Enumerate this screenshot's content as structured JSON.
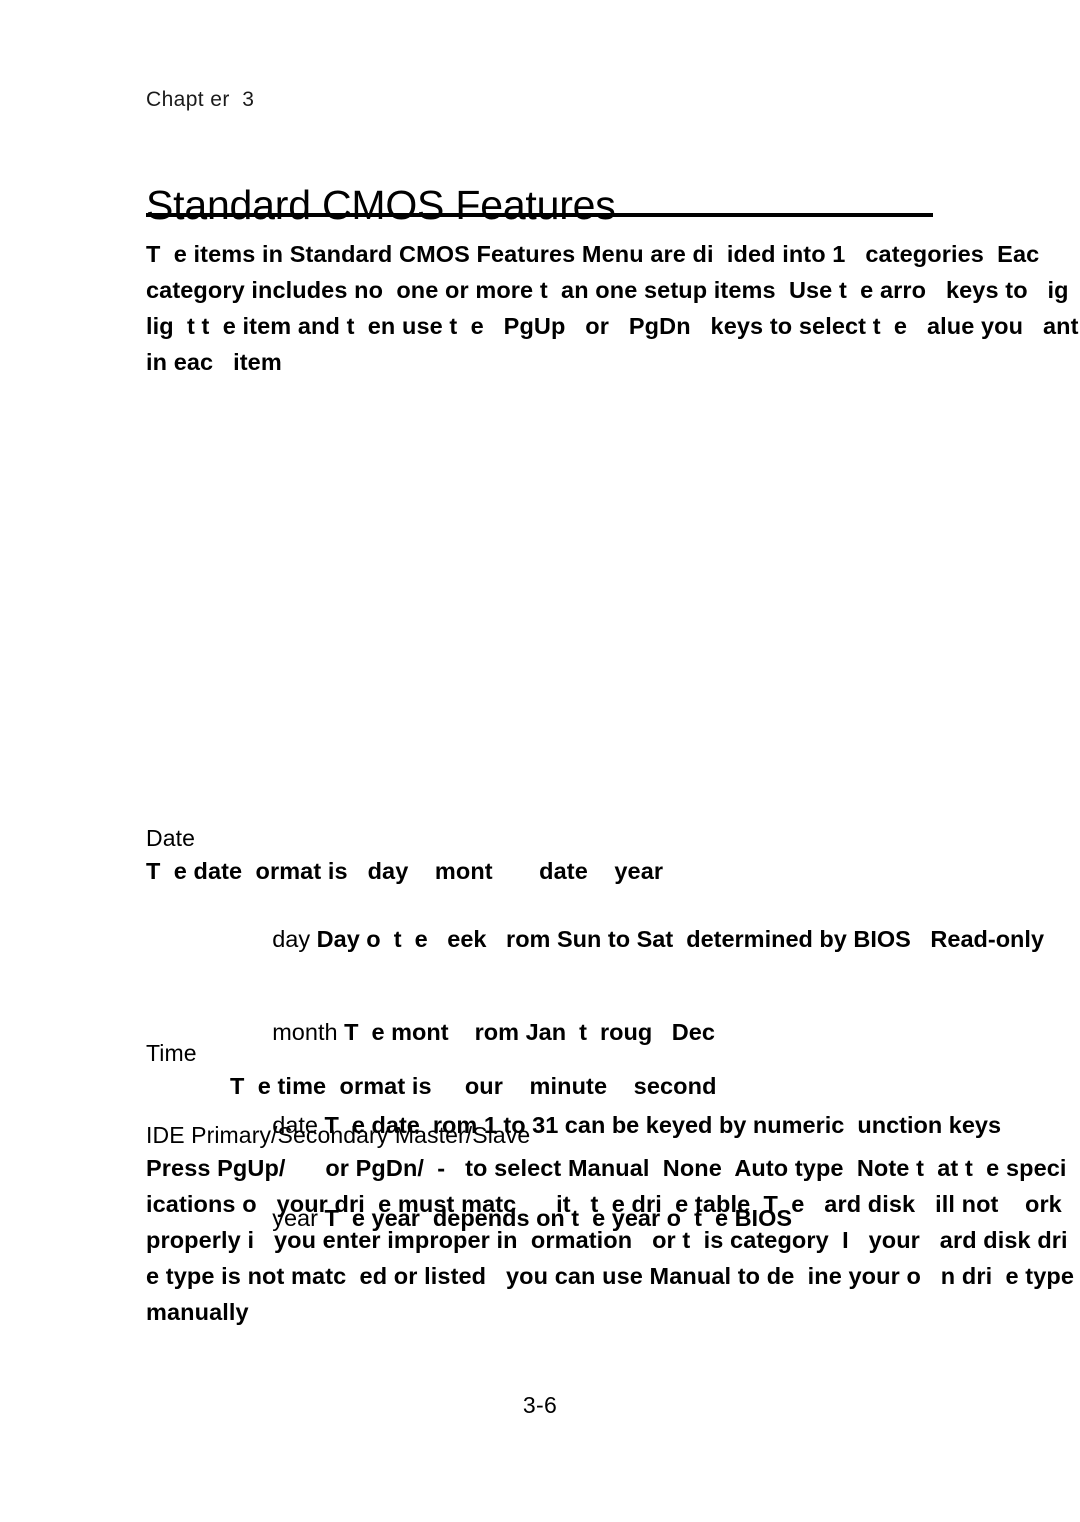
{
  "document": {
    "chapter_label": "Chapt er  3",
    "title": "Standard CMOS Features",
    "page_number": "3-6"
  },
  "intro": {
    "text": "T  e items in Standard CMOS Features Menu are di  ided into 1   categories  Eac   category includes no  one or more t  an one setup items  Use t  e arro   keys to   ig  lig  t t  e item and t  en use t  e   PgUp   or   PgDn   keys to select t  e   alue you   ant in eac   item"
  },
  "sections": [
    {
      "name": "date",
      "heading": "Date",
      "body": "T  e date  ormat is   day    mont       date    year",
      "definitions": [
        {
          "term": "day",
          "desc": "Day o  t  e   eek   rom Sun to Sat  determined by BIOS   Read-only"
        },
        {
          "term": "month",
          "desc": "T  e mont    rom Jan  t  roug   Dec"
        },
        {
          "term": "date",
          "desc": "T  e date  rom 1 to 31 can be keyed by numeric  unction keys"
        },
        {
          "term": "year",
          "desc": "T  e year  depends on t  e year o  t  e BIOS"
        }
      ]
    },
    {
      "name": "time",
      "heading": "Time",
      "body": "T  e time  ormat is     our    minute    second",
      "definitions": []
    },
    {
      "name": "ide-primary-secondary-master-slave",
      "heading": "IDE Primary/Secondary Master/Slave",
      "body": "Press PgUp/      or PgDn/  -   to select Manual  None  Auto type  Note t  at t  e speci  ications o   your dri  e must matc      it   t  e dri  e table  T  e   ard disk   ill not    ork properly i   you enter improper in  ormation   or t  is category  I   your   ard disk dri  e type is not matc  ed or listed   you can use Manual to de  ine your o   n dri  e type manually",
      "definitions": []
    }
  ]
}
